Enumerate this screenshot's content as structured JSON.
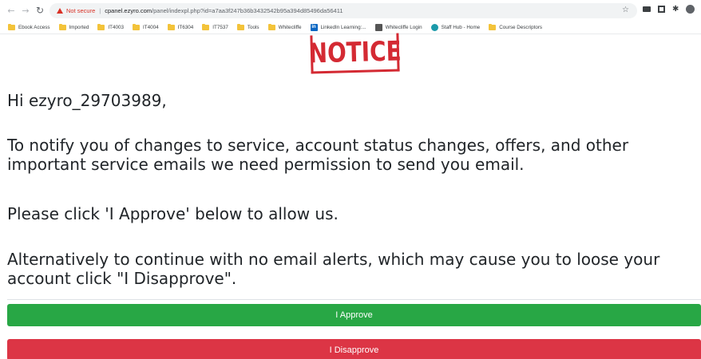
{
  "browser": {
    "security_label": "Not secure",
    "url_domain": "cpanel.ezyro.com",
    "url_path": "/panel/indexpl.php?id=a7aa3f247b36b3432542b95a394d85496da56411",
    "bookmarks": [
      {
        "label": "Ebook Access",
        "icon": "folder-icon"
      },
      {
        "label": "Imported",
        "icon": "folder-icon"
      },
      {
        "label": "IT4003",
        "icon": "folder-icon"
      },
      {
        "label": "IT4004",
        "icon": "folder-icon"
      },
      {
        "label": "IT6304",
        "icon": "folder-icon"
      },
      {
        "label": "IT7537",
        "icon": "folder-icon"
      },
      {
        "label": "Tools",
        "icon": "folder-icon"
      },
      {
        "label": "Whitecliffe",
        "icon": "folder-icon"
      },
      {
        "label": "LinkedIn Learning:...",
        "icon": "linkedin-icon"
      },
      {
        "label": "Whitecliffe Login",
        "icon": "whitecliffe-icon"
      },
      {
        "label": "Staff Hub - Home",
        "icon": "staff-hub-icon"
      },
      {
        "label": "Course Descriptors",
        "icon": "folder-icon"
      }
    ]
  },
  "page": {
    "stamp_text": "NOTICE",
    "greeting": "Hi ezyro_29703989,",
    "paragraph_1": "To notify you of changes to service, account status changes, offers, and other important service emails we need permission to send you email.",
    "paragraph_2": "Please click 'I Approve' below to allow us.",
    "paragraph_3": "Alternatively to continue with no email alerts, which may cause you to loose your account click \"I Disapprove\".",
    "approve_label": "I Approve",
    "disapprove_label": "I Disapprove"
  },
  "colors": {
    "approve": "#28a745",
    "disapprove": "#dc3545",
    "stamp": "#d42a33",
    "warning": "#d93025"
  }
}
